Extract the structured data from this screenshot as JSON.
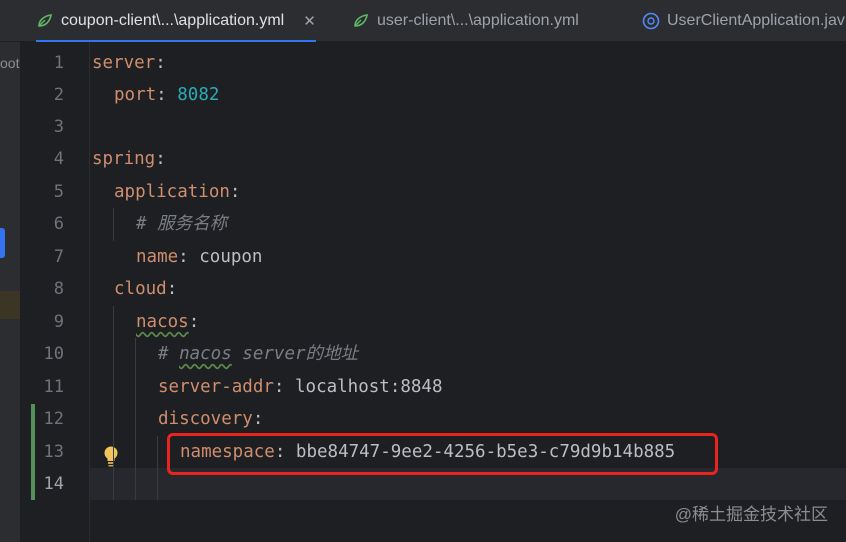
{
  "tabs": [
    {
      "label": "coupon-client\\...\\application.yml",
      "icon": "yaml-file-icon",
      "active": true,
      "close": "✕"
    },
    {
      "label": "user-client\\...\\application.yml",
      "icon": "yaml-file-icon",
      "active": false
    },
    {
      "label": "UserClientApplication.jav",
      "icon": "java-class-icon",
      "active": false
    }
  ],
  "sidebar": {
    "text": "oot"
  },
  "lines": [
    {
      "num": "1"
    },
    {
      "num": "2"
    },
    {
      "num": "3"
    },
    {
      "num": "4"
    },
    {
      "num": "5"
    },
    {
      "num": "6"
    },
    {
      "num": "7"
    },
    {
      "num": "8"
    },
    {
      "num": "9"
    },
    {
      "num": "10"
    },
    {
      "num": "11"
    },
    {
      "num": "12"
    },
    {
      "num": "13"
    },
    {
      "num": "14"
    }
  ],
  "code": {
    "server_key": "server",
    "colon": ":",
    "port_key": "port",
    "port_value": "8082",
    "spring_key": "spring",
    "application_key": "application",
    "comment_service_name": "# 服务名称",
    "name_key": "name",
    "name_value": "coupon",
    "cloud_key": "cloud",
    "nacos_key": "nacos",
    "comment_hash": "# ",
    "comment_nacos_word": "nacos",
    "comment_nacos_rest": " server的地址",
    "server_addr_key": "server-addr",
    "server_addr_value": "localhost:8848",
    "discovery_key": "discovery",
    "namespace_key": "namespace",
    "namespace_value": "bbe84747-9ee2-4256-b5e3-c79d9b14b885"
  },
  "watermark": "@稀土掘金技术社区",
  "colors": {
    "highlight_box": "#e8241f",
    "keyword": "#cf8e6d",
    "number": "#2aacb8",
    "comment": "#7a7e85"
  }
}
